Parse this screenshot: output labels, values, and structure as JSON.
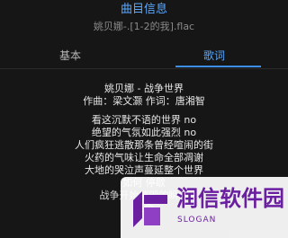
{
  "header": {
    "title": "曲目信息",
    "filename": "姚贝娜-.[1-2的我].flac"
  },
  "tabs": [
    {
      "label": "基本",
      "active": false
    },
    {
      "label": "歌词",
      "active": true
    }
  ],
  "lyrics": {
    "song_title": "姚贝娜 - 战争世界",
    "credits": "作曲：梁文灏    作词：唐湘智",
    "lines": [
      "看这沉默不语的世界 no",
      "绝望的气氛如此强烈 no",
      "人们疯狂逃散那条曾经喧闹的街",
      "火药的气味让生命全部凋谢",
      "大地的哭泣声蔓延整个世界",
      "如何 停歇",
      "战争开始摧毁的瞬间",
      "整个"
    ]
  },
  "colors": {
    "accent": "#5aa8ff",
    "background": "#161616",
    "watermark_purple": "#6a1fa0"
  },
  "watermark": {
    "brand": "润信软件园",
    "slogan": "SLOGAN"
  }
}
